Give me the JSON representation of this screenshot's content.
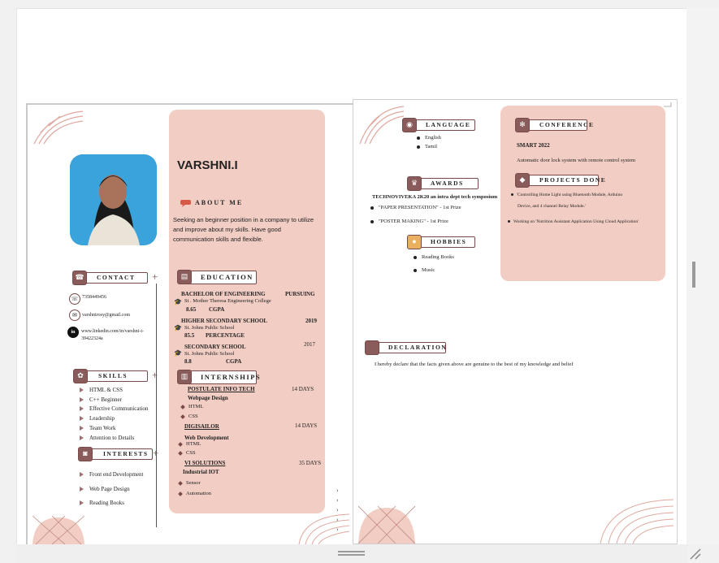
{
  "name": "VARSHNI.I",
  "about": {
    "title": "ABOUT ME",
    "lines": [
      "Seeking an beginner position in a company to utilize",
      "and    improve    about    my    skills.    Have    good",
      "communication skills and flexible."
    ]
  },
  "contact": {
    "title": "CONTACT",
    "phone": "7358449456",
    "email": "varshnirosy@gmail.com",
    "linkedin": [
      "www.linkedin.com/in/varshni-i-",
      "39422324a"
    ]
  },
  "education": {
    "title": "EDUCATION",
    "items": [
      {
        "degree": "BACHELOR OF ENGINEERING",
        "year": "PURSUING",
        "school": "St . Mother Theresa Engineering College",
        "score": "8.65",
        "unit": "CGPA"
      },
      {
        "degree": "HIGHER SECONDARY SCHOOL",
        "year": "2019",
        "school": "St. Johns Public School",
        "score": "85.5",
        "unit": "PERCENTAGE"
      },
      {
        "degree": "SECONDARY SCHOOL",
        "year": "2017",
        "school": "St. Johns Public School",
        "score": "8.8",
        "unit": "CGPA"
      }
    ]
  },
  "skills": {
    "title": "SKILLS",
    "items": [
      "HTML & CSS",
      "C++ Beginner",
      "Effective Communication",
      "Leadership",
      "Team Work",
      "Attention to Details"
    ]
  },
  "interests": {
    "title": "INTERESTS",
    "items": [
      "Front end Development",
      "Web Page Design",
      "Reading Books"
    ]
  },
  "internships": {
    "title": "INTERNSHIPS",
    "items": [
      {
        "company": "POSTULATE INFO TECH",
        "duration": "14 DAYS",
        "role": "Webpage Design",
        "skills": [
          "HTML",
          "CSS"
        ]
      },
      {
        "company": "DIGISAILOR",
        "duration": "14 DAYS",
        "role": "Web Development",
        "skills": [
          "HTML",
          "CSS"
        ]
      },
      {
        "company": "VI SOLUTIONS",
        "duration": "35 DAYS",
        "role": "Industrial IOT",
        "skills": [
          "Sensor",
          "Automation"
        ]
      }
    ]
  },
  "language": {
    "title": "LANGUAGE",
    "items": [
      "English",
      "Tamil"
    ]
  },
  "awards": {
    "title": "AWARDS",
    "event": "TECHNOVIVEKA 2K20 an intra dept tech symposium",
    "items": [
      "\"PAPER PRESENTATION\"  -  1st Prize",
      "\"POSTER MAKING\"  -   1st Prize"
    ]
  },
  "hobbies": {
    "title": "HOBBIES",
    "items": [
      "Reading Books",
      "Music"
    ]
  },
  "conference": {
    "title": "CONFERENCE",
    "name": "SMART 2022",
    "desc": "Automatic door lock system with remote control system"
  },
  "projects": {
    "title": "PROJECTS DONE",
    "items": [
      [
        "'Controlling  Home  Light  using  Bluetooth  Module,  Arduino",
        "Device, and 4 channel Relay Module.'"
      ],
      [
        "Working on 'Nutrition Assistant Application Using Cloud Application'"
      ]
    ]
  },
  "declaration": {
    "title": "DECLARATION",
    "text": "I hereby declare that the facts given above are genuine to the best of my knowledge and belief"
  },
  "colors": {
    "accent_pink": "#f2cdc4",
    "accent_brown": "#7a4a4a"
  }
}
